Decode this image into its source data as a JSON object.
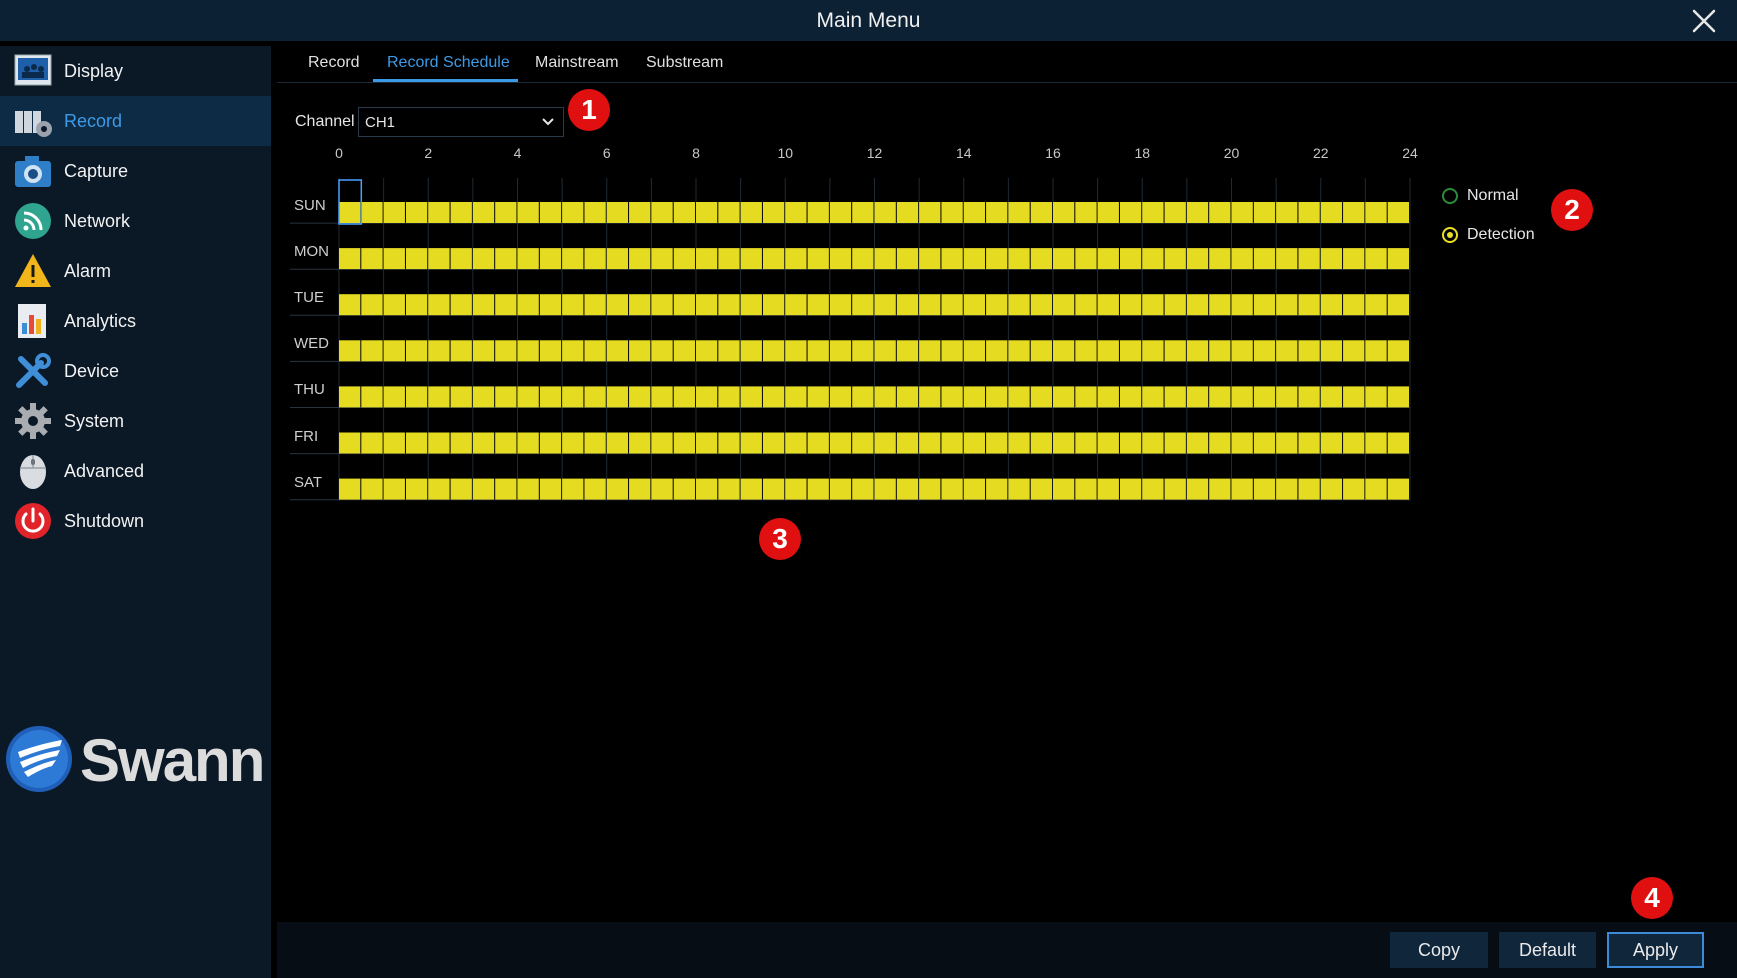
{
  "window": {
    "title": "Main Menu"
  },
  "sidebar": {
    "items": [
      {
        "label": "Display",
        "icon": "display-icon"
      },
      {
        "label": "Record",
        "icon": "record-icon",
        "active": true
      },
      {
        "label": "Capture",
        "icon": "camera-icon"
      },
      {
        "label": "Network",
        "icon": "network-icon"
      },
      {
        "label": "Alarm",
        "icon": "alarm-icon"
      },
      {
        "label": "Analytics",
        "icon": "analytics-icon"
      },
      {
        "label": "Device",
        "icon": "device-tools-icon"
      },
      {
        "label": "System",
        "icon": "gear-icon"
      },
      {
        "label": "Advanced",
        "icon": "mouse-icon"
      },
      {
        "label": "Shutdown",
        "icon": "power-icon"
      }
    ],
    "logo_text": "Swann"
  },
  "tabs": [
    {
      "label": "Record"
    },
    {
      "label": "Record Schedule",
      "active": true
    },
    {
      "label": "Mainstream"
    },
    {
      "label": "Substream"
    }
  ],
  "channel": {
    "label": "Channel",
    "value": "CH1"
  },
  "schedule": {
    "hour_ticks": [
      "0",
      "2",
      "4",
      "6",
      "8",
      "10",
      "12",
      "14",
      "16",
      "18",
      "20",
      "22",
      "24"
    ],
    "days": [
      "SUN",
      "MON",
      "TUE",
      "WED",
      "THU",
      "FRI",
      "SAT"
    ],
    "slots_per_day": 48,
    "fill_color": "#e5dc22",
    "mode": "Detection"
  },
  "legend": {
    "normal": "Normal",
    "detection": "Detection",
    "normal_color": "#2e8b3a",
    "detection_color": "#e8e024"
  },
  "markers": [
    "1",
    "2",
    "3",
    "4"
  ],
  "buttons": {
    "copy": "Copy",
    "default": "Default",
    "apply": "Apply"
  }
}
